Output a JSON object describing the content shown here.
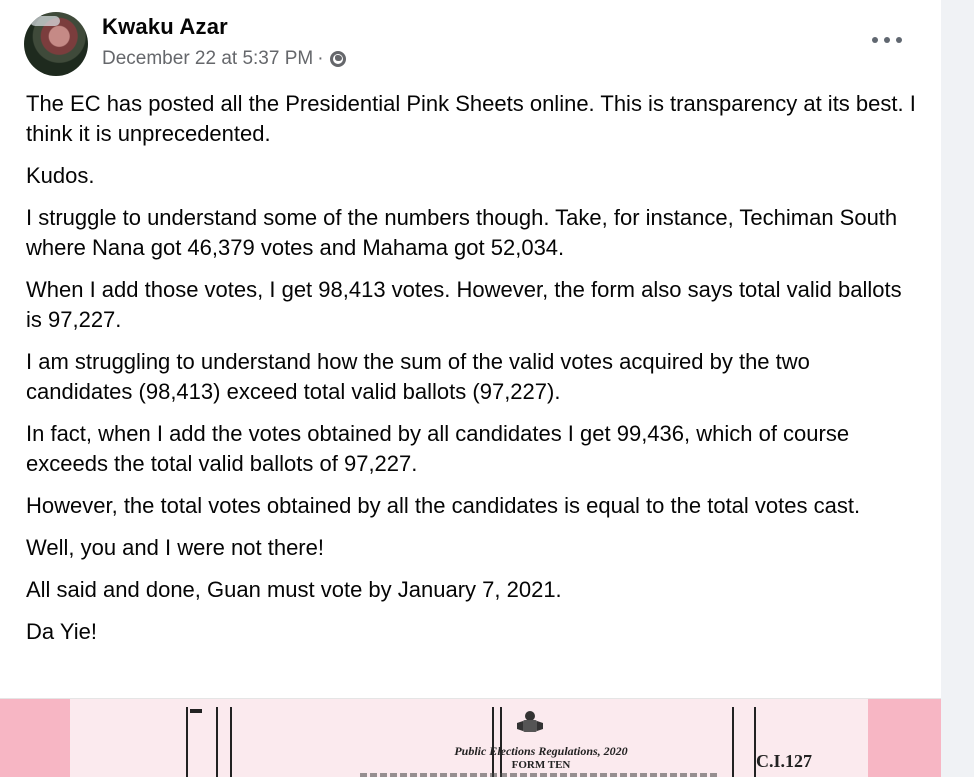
{
  "post": {
    "author": "Kwaku Azar",
    "timestamp": "December 22 at 5:37 PM",
    "separator": "·",
    "privacy_icon": "globe-icon",
    "more_icon": "more-options-icon",
    "paragraphs": [
      "The EC has posted all the Presidential Pink Sheets online. This is transparency at its best. I think it is unprecedented.",
      "Kudos.",
      "I struggle to understand some of the numbers though. Take, for instance, Techiman South where Nana got 46,379 votes and Mahama got 52,034.",
      "When I add those votes, I get 98,413 votes.  However, the form also says total valid ballots is 97,227.",
      "I am struggling to understand how the sum of the valid votes acquired by the two candidates (98,413) exceed total valid ballots (97,227).",
      "In fact, when I add the votes obtained by all candidates I get 99,436, which of course exceeds the total valid ballots of 97,227.",
      "However, the total votes obtained by all the candidates is equal to the total votes cast.",
      "Well, you and I were not there!",
      "All said and done, Guan must vote by January 7, 2021.",
      "Da Yie!"
    ]
  },
  "attachment": {
    "form_title": "Public Elections Regulations, 2020",
    "form_subtitle": "FORM TEN",
    "form_code": "C.I.127",
    "crest_icon": "coat-of-arms-icon",
    "background_color": "#f7b6c4"
  }
}
